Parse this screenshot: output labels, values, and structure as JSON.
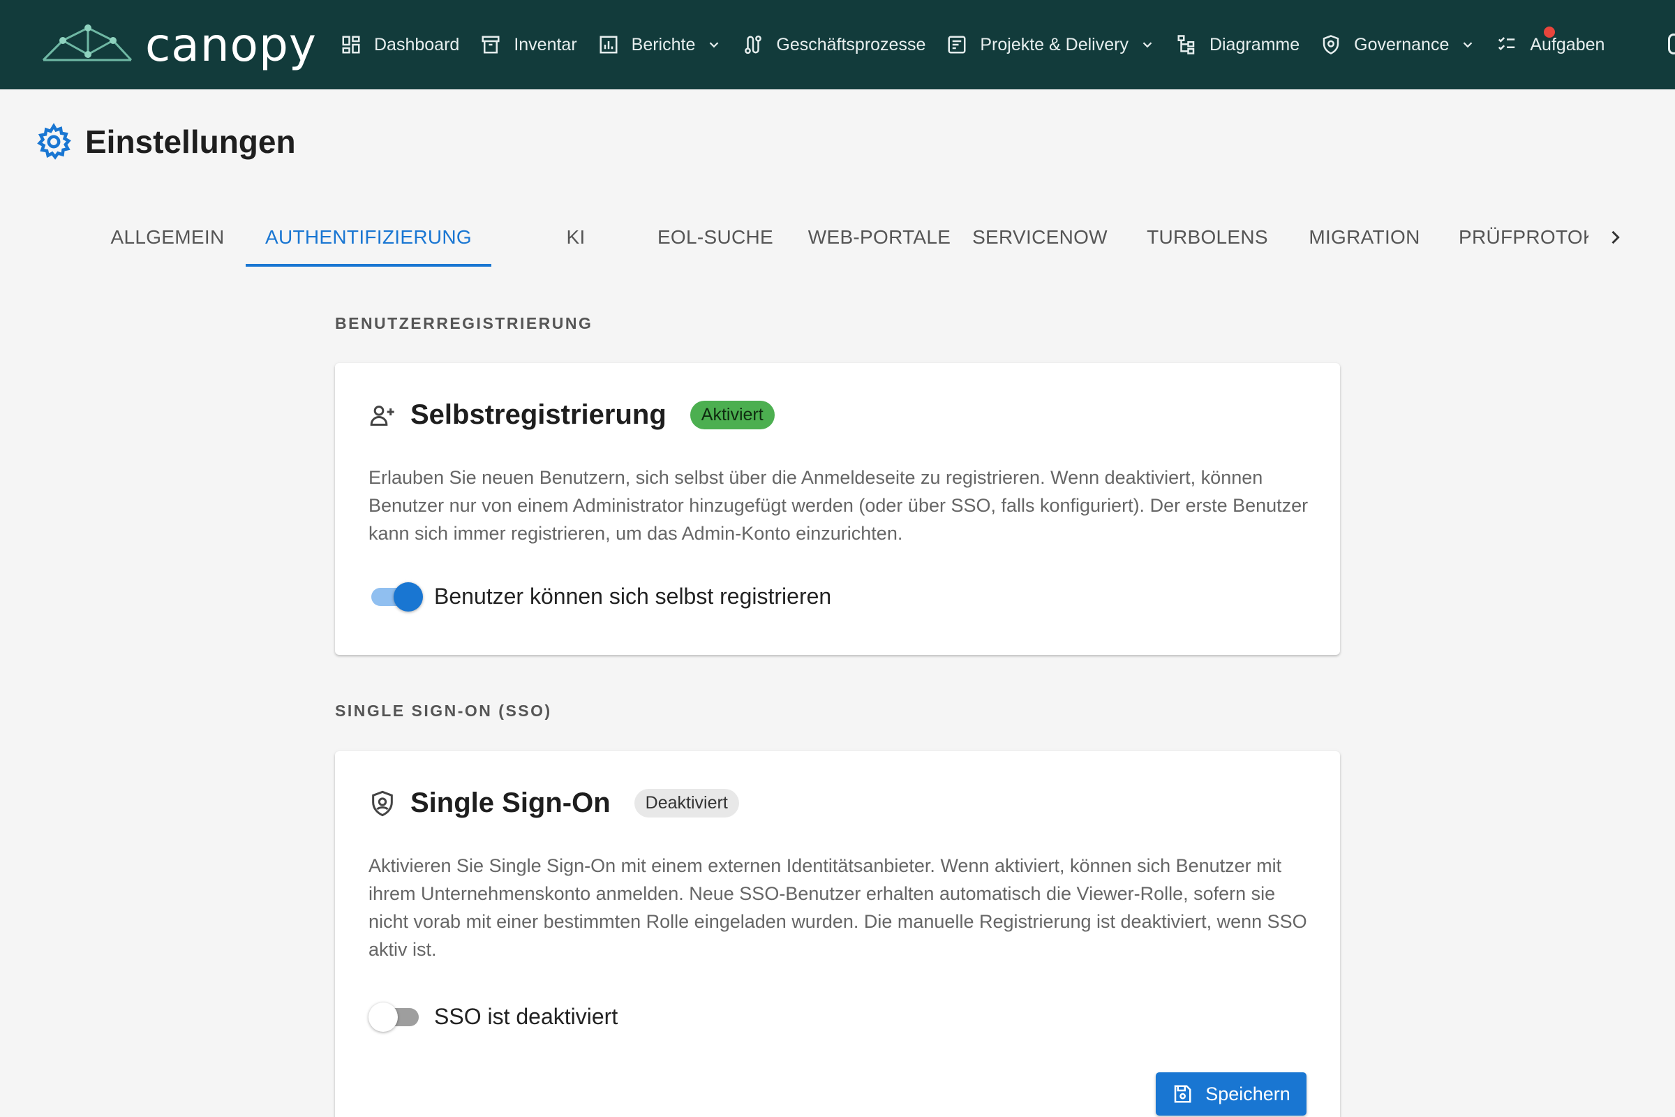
{
  "brand": {
    "name": "canopy",
    "accent": "#123b3b"
  },
  "nav": {
    "items": [
      {
        "label": "Dashboard",
        "icon": "dashboard-icon"
      },
      {
        "label": "Inventar",
        "icon": "archive-icon"
      },
      {
        "label": "Berichte",
        "icon": "bar-chart-icon",
        "dropdown": true
      },
      {
        "label": "Geschäftsprozesse",
        "icon": "process-icon"
      },
      {
        "label": "Projekte & Delivery",
        "icon": "project-icon",
        "dropdown": true
      },
      {
        "label": "Diagramme",
        "icon": "hierarchy-icon"
      },
      {
        "label": "Governance",
        "icon": "shield-icon",
        "dropdown": true
      },
      {
        "label": "Aufgaben",
        "icon": "checklist-icon",
        "notification": true
      }
    ]
  },
  "page": {
    "title": "Einstellungen",
    "icon": "gear-icon"
  },
  "tabs": [
    {
      "label": "ALLGEMEIN",
      "active": false
    },
    {
      "label": "AUTHENTIFIZIERUNG",
      "active": true
    },
    {
      "label": "KI",
      "active": false
    },
    {
      "label": "EOL-SUCHE",
      "active": false
    },
    {
      "label": "WEB-PORTALE",
      "active": false
    },
    {
      "label": "SERVICENOW",
      "active": false
    },
    {
      "label": "TURBOLENS",
      "active": false
    },
    {
      "label": "MIGRATION",
      "active": false
    },
    {
      "label": "PRÜFPROTOKOLL",
      "active": false
    }
  ],
  "registration": {
    "section_label": "BENUTZERREGISTRIERUNG",
    "title": "Selbstregistrierung",
    "badge": "Aktiviert",
    "description": "Erlauben Sie neuen Benutzern, sich selbst über die Anmeldeseite zu registrieren. Wenn deaktiviert, können Benutzer nur von einem Administrator hinzugefügt werden (oder über SSO, falls konfiguriert). Der erste Benutzer kann sich immer registrieren, um das Admin-Konto einzurichten.",
    "toggle_label": "Benutzer können sich selbst registrieren",
    "enabled": true
  },
  "sso": {
    "section_label": "SINGLE SIGN-ON (SSO)",
    "title": "Single Sign-On",
    "badge": "Deaktiviert",
    "description": "Aktivieren Sie Single Sign-On mit einem externen Identitätsanbieter. Wenn aktiviert, können sich Benutzer mit ihrem Unternehmenskonto anmelden. Neue SSO-Benutzer erhalten automatisch die Viewer-Rolle, sofern sie nicht vorab mit einer bestimmten Rolle eingeladen wurden. Die manuelle Registrierung ist deaktiviert, wenn SSO aktiv ist.",
    "toggle_label": "SSO ist deaktiviert",
    "enabled": false,
    "save_label": "Speichern"
  },
  "colors": {
    "primary": "#1976d2",
    "success": "#4caf50",
    "notification": "#e8453c"
  }
}
